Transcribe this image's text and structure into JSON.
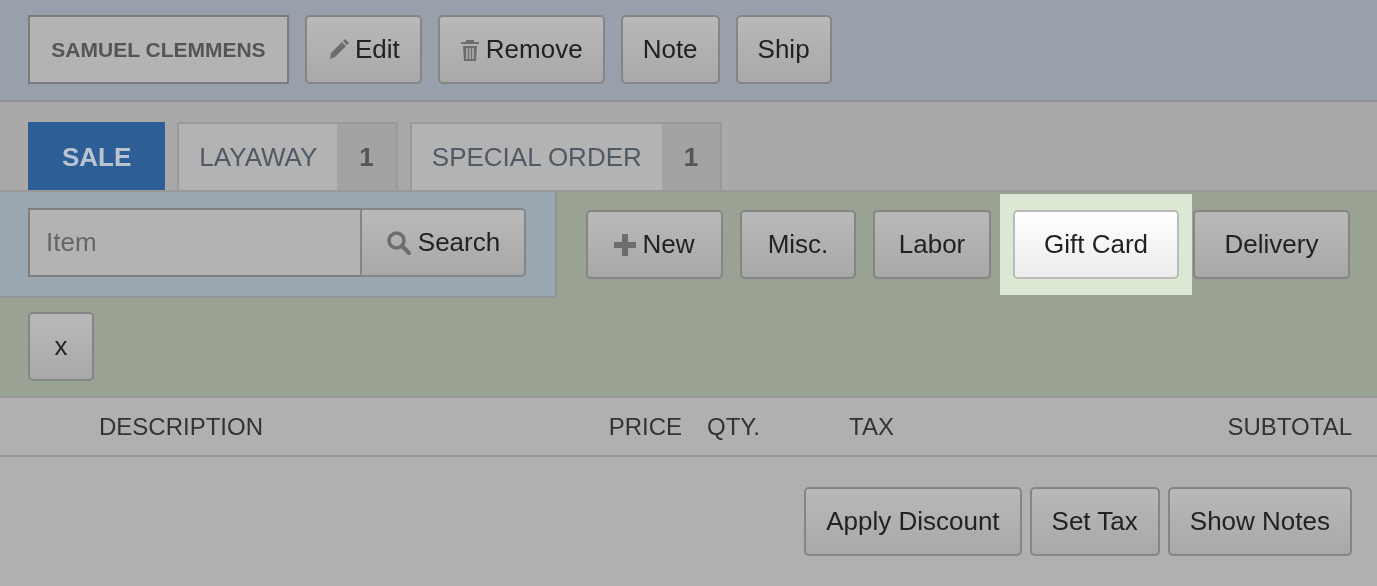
{
  "customer": {
    "name": "SAMUEL CLEMMENS"
  },
  "actions": [
    {
      "label": "Edit",
      "kind": "edit"
    },
    {
      "label": "Remove",
      "kind": "remove"
    },
    {
      "label": "Note",
      "kind": "plain"
    },
    {
      "label": "Ship",
      "kind": "plain"
    }
  ],
  "tabs": [
    {
      "label": "SALE",
      "selected": true
    },
    {
      "label": "LAYAWAY",
      "count": "1",
      "selected": false
    },
    {
      "label": "SPECIAL ORDER",
      "count": "1",
      "selected": false
    }
  ],
  "item_search": {
    "placeholder": "Item",
    "button": "Search"
  },
  "add_buttons": [
    {
      "label": "New",
      "kind": "new",
      "highlighted": false
    },
    {
      "label": "Misc.",
      "kind": "plain",
      "highlighted": false
    },
    {
      "label": "Labor",
      "kind": "plain",
      "highlighted": false
    },
    {
      "label": "Gift Card",
      "kind": "plain",
      "highlighted": true
    },
    {
      "label": "Delivery",
      "kind": "plain",
      "highlighted": false
    }
  ],
  "clear_button": "x",
  "table": {
    "columns": [
      "DESCRIPTION",
      "PRICE",
      "QTY.",
      "TAX",
      "SUBTOTAL"
    ]
  },
  "footer_buttons": [
    "Apply Discount",
    "Set Tax",
    "Show Notes"
  ]
}
